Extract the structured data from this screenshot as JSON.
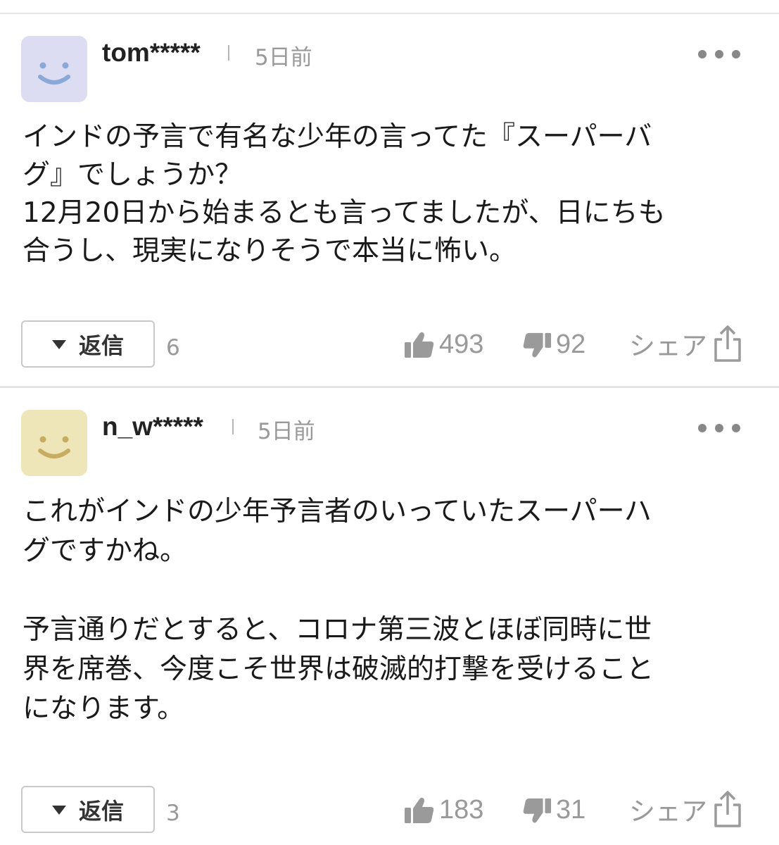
{
  "comments": [
    {
      "username": "tom*****",
      "timestamp": "5日前",
      "avatar_color": "#dcdcf2",
      "avatar_face_color": "#8aa8d8",
      "avatar_icon": "smiley-face-icon",
      "body": "インドの予言で有名な少年の言ってた『スーパーバ\nグ』でしょうか？\n12月20日から始まるとも言ってましたが、日にちも\n合うし、現実になりそうで本当に怖い。",
      "reply_label": "返信",
      "reply_count": "6",
      "like_count": "493",
      "dislike_count": "92",
      "share_label": "シェア"
    },
    {
      "username": "n_w*****",
      "timestamp": "5日前",
      "avatar_color": "#eee5b8",
      "avatar_face_color": "#c7ad62",
      "avatar_icon": "smiley-face-icon",
      "body": "これがインドの少年予言者のいっていたスーパーハ\nグですかね。\n\n予言通りだとすると、コロナ第三波とほぼ同時に世\n界を席巻、今度こそ世界は破滅的打撃を受けること\nになります。",
      "reply_label": "返信",
      "reply_count": "3",
      "like_count": "183",
      "dislike_count": "31",
      "share_label": "シェア"
    }
  ],
  "colors": {
    "text": "#1a1a1a",
    "muted": "#999999",
    "divider": "#e4e4e4",
    "border": "#c9c9c9"
  }
}
